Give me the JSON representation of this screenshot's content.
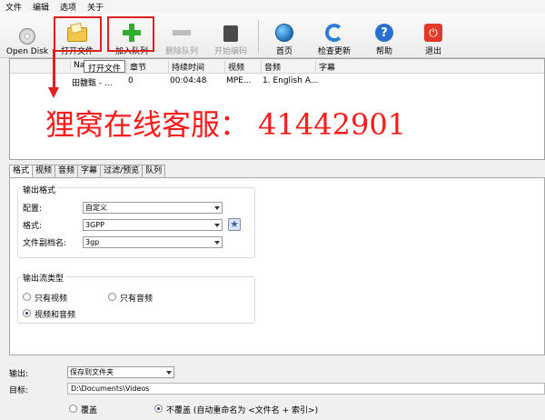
{
  "menu": [
    "文件",
    "编辑",
    "选项",
    "关于"
  ],
  "toolbar": {
    "open_disk": "Open Disk",
    "open_file": "打开文件",
    "add_queue": "加入队列",
    "remove_queue": "删除队列",
    "start_encode": "开始编码",
    "home": "首页",
    "check_update": "检查更新",
    "help": "帮助",
    "exit": "退出"
  },
  "tooltip": "打开文件",
  "filelist": {
    "columns": [
      "Nam",
      "章节",
      "持续时间",
      "视频",
      "音频",
      "字幕"
    ],
    "rows": [
      {
        "name": "田馥甄 - ...",
        "chapter": "0",
        "duration": "00:04:48",
        "video": "MPE...",
        "audio": "1. English A...",
        "subtitle": ""
      }
    ]
  },
  "watermark": "狸窝在线客服： 41442901",
  "tabs": [
    "格式",
    "视频",
    "音频",
    "字幕",
    "过滤/预览",
    "队列"
  ],
  "active_tab": "格式",
  "output_format": {
    "title": "输出格式",
    "preset_label": "配置:",
    "preset_value": "自定义",
    "format_label": "格式:",
    "format_value": "3GPP",
    "ext_label": "文件副档名:",
    "ext_value": "3gp"
  },
  "stream_type": {
    "title": "输出流类型",
    "video_only": "只有视频",
    "audio_only": "只有音频",
    "video_audio": "视频和音频",
    "selected": "视频和音频"
  },
  "output": {
    "label": "输出:",
    "value": "保存到文件夹",
    "target_label": "目标:",
    "target_value": "D:\\Documents\\Videos",
    "overwrite": "覆盖",
    "no_overwrite": "不覆盖 (自动重命名为 <文件名 + 索引>)",
    "selected": "不覆盖"
  },
  "colors": {
    "annotation_red": "#e02020",
    "watermark_red": "#ff1a1a"
  }
}
